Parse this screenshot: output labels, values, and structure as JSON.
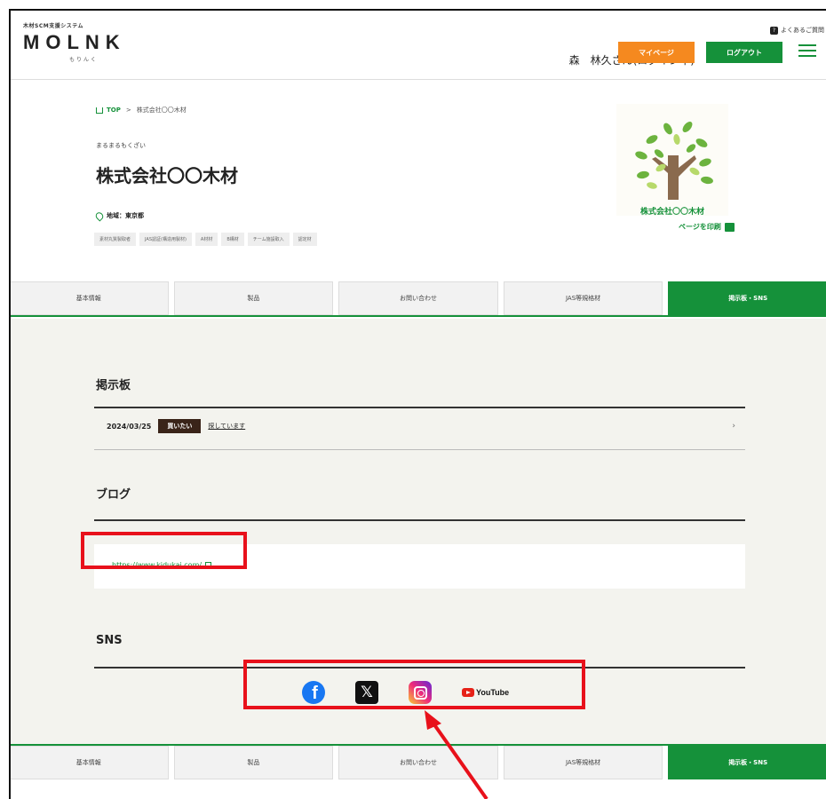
{
  "header": {
    "system_name": "木材SCM支援システム",
    "logo": "MOLNK",
    "logo_kana": "もりんく",
    "faq_label": "よくあるご質問",
    "user_greeting": "森　林久さん(ログイン中)",
    "mypage_label": "マイページ",
    "logout_label": "ログアウト"
  },
  "breadcrumb": {
    "top": "TOP",
    "separator": ">",
    "current": "株式会社〇〇木材"
  },
  "company": {
    "kana": "まるまるもくざい",
    "name": "株式会社〇〇木材",
    "location": "地域：東京都",
    "tags": [
      "素材丸質製取者",
      "JAS認証(構造用製材)",
      "A材材",
      "B構材",
      "チーム施設取入",
      "認定材"
    ],
    "logo_caption": "株式会社〇〇木材",
    "print_label": "ページを印刷"
  },
  "tabs": [
    {
      "label": "基本情報",
      "active": false
    },
    {
      "label": "製品",
      "active": false
    },
    {
      "label": "お問い合わせ",
      "active": false
    },
    {
      "label": "JAS等規格材",
      "active": false
    },
    {
      "label": "掲示板・SNS",
      "active": true
    }
  ],
  "board": {
    "title": "掲示板",
    "date": "2024/03/25",
    "badge": "買いたい",
    "link_text": "探しています",
    "chevron": "›"
  },
  "blog": {
    "title": "ブログ",
    "url": "https://www.kidukai.com/"
  },
  "sns": {
    "title": "SNS",
    "icons": [
      "facebook-icon",
      "x-icon",
      "instagram-icon",
      "youtube-icon"
    ],
    "youtube_label": "YouTube"
  },
  "colors": {
    "brand_green": "#15913a",
    "accent_orange": "#f5891f",
    "annotation_red": "#e8111b",
    "badge_brown": "#3a2419"
  }
}
